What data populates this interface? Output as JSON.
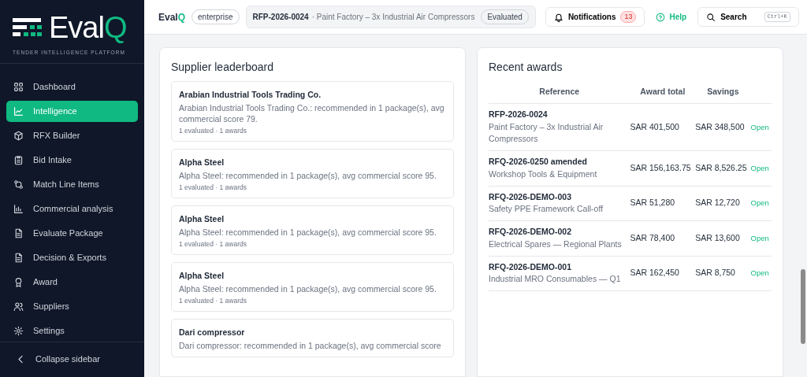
{
  "sidebar": {
    "logo": {
      "text": "Eval",
      "accent": "Q"
    },
    "tagline": "TENDER INTELLIGENCE PLATFORM",
    "items": [
      {
        "label": "Dashboard",
        "selected": false
      },
      {
        "label": "Intelligence",
        "selected": true
      },
      {
        "label": "RFX Builder",
        "selected": false
      },
      {
        "label": "Bid Intake",
        "selected": false
      },
      {
        "label": "Match Line Items",
        "selected": false
      },
      {
        "label": "Commercial analysis",
        "selected": false
      },
      {
        "label": "Evaluate Package",
        "selected": false
      },
      {
        "label": "Decision & Exports",
        "selected": false
      },
      {
        "label": "Award",
        "selected": false
      },
      {
        "label": "Suppliers",
        "selected": false
      },
      {
        "label": "Settings",
        "selected": false
      }
    ],
    "collapse": "Collapse sidebar"
  },
  "topbar": {
    "brand": {
      "text": "Eval",
      "accent": "Q"
    },
    "plan": "enterprise",
    "context": {
      "reference": "RFP-2026-0024",
      "title": "· Paint Factory – 3x Industrial Air Compressors",
      "status": "Evaluated"
    },
    "notifications": {
      "label": "Notifications",
      "count": "13"
    },
    "help": "Help",
    "search": {
      "label": "Search",
      "shortcut": "Ctrl+K"
    }
  },
  "leaderboard": {
    "title": "Supplier leaderboard",
    "suppliers": [
      {
        "name": "Arabian Industrial Tools Trading Co.",
        "summary": "Arabian Industrial Tools Trading Co.: recommended in 1 package(s), avg commercial score 79.",
        "stats": "1 evaluated · 1 awards"
      },
      {
        "name": "Alpha Steel",
        "summary": "Alpha Steel: recommended in 1 package(s), avg commercial score 95.",
        "stats": "1 evaluated · 1 awards"
      },
      {
        "name": "Alpha Steel",
        "summary": "Alpha Steel: recommended in 1 package(s), avg commercial score 95.",
        "stats": "1 evaluated · 1 awards"
      },
      {
        "name": "Alpha Steel",
        "summary": "Alpha Steel: recommended in 1 package(s), avg commercial score 95.",
        "stats": "1 evaluated · 1 awards"
      },
      {
        "name": "Dari compressor",
        "summary": "Dari compressor: recommended in 1 package(s), avg commercial score"
      }
    ]
  },
  "awards": {
    "title": "Recent awards",
    "columns": [
      "Reference",
      "Award total",
      "Savings"
    ],
    "rows": [
      {
        "reference": "RFP-2026-0024",
        "title": "Paint Factory – 3x Industrial Air Compressors",
        "total": "SAR 401,500",
        "savings": "SAR 348,500",
        "action": "Open"
      },
      {
        "reference": "RFQ-2026-0250 amended",
        "title": "Workshop Tools & Equipment",
        "total": "SAR 156,163.75",
        "savings": "SAR 8,526.25",
        "action": "Open"
      },
      {
        "reference": "RFQ-2026-DEMO-003",
        "title": "Safety PPE Framework Call-off",
        "total": "SAR 51,280",
        "savings": "SAR 12,720",
        "action": "Open"
      },
      {
        "reference": "RFQ-2026-DEMO-002",
        "title": "Electrical Spares — Regional Plants",
        "total": "SAR 78,400",
        "savings": "SAR 13,600",
        "action": "Open"
      },
      {
        "reference": "RFQ-2026-DEMO-001",
        "title": "Industrial MRO Consumables — Q1",
        "total": "SAR 162,450",
        "savings": "SAR 8,750",
        "action": "Open"
      }
    ]
  }
}
